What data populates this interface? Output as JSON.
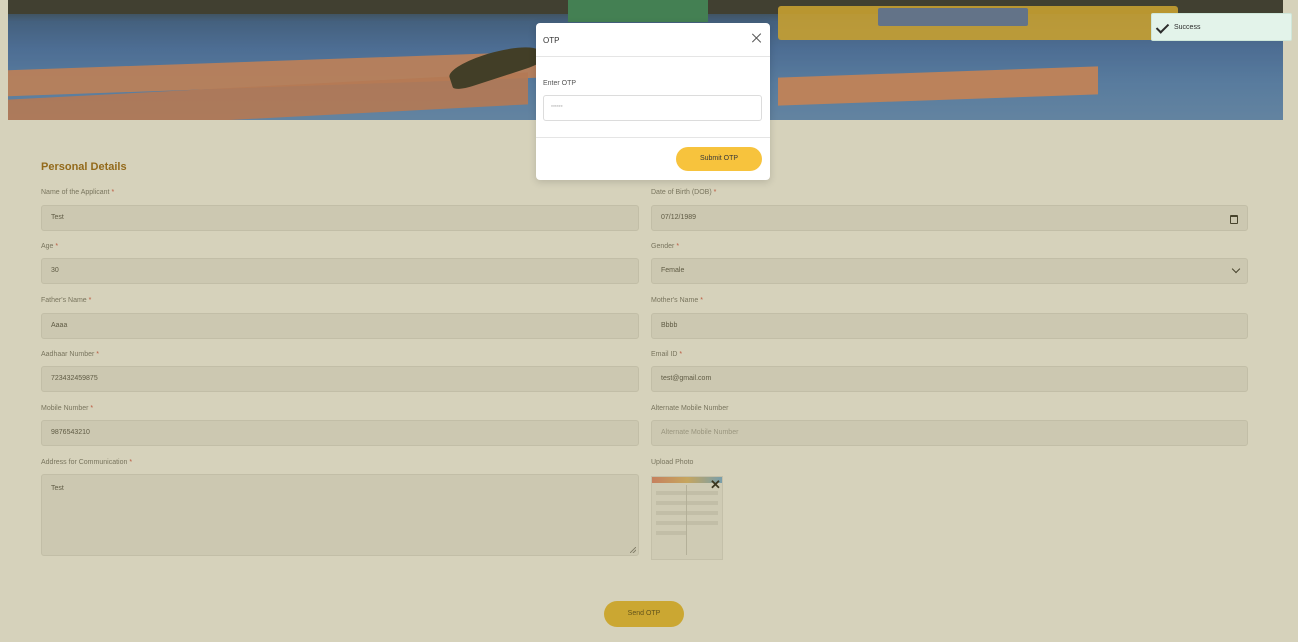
{
  "form": {
    "section_title": "Personal Details",
    "fields": {
      "applicant_name": {
        "label": "Name of the Applicant",
        "value": "Test"
      },
      "dob": {
        "label": "Date of Birth (DOB)",
        "value": "07/12/1989"
      },
      "age": {
        "label": "Age",
        "value": "30"
      },
      "gender": {
        "label": "Gender",
        "value": "Female"
      },
      "father_name": {
        "label": "Father's Name",
        "value": "Aaaa"
      },
      "mother_name": {
        "label": "Mother's Name",
        "value": "Bbbb"
      },
      "aadhaar": {
        "label": "Aadhaar Number",
        "value": "723432459875"
      },
      "email": {
        "label": "Email ID",
        "value": "test@gmail.com"
      },
      "mobile": {
        "label": "Mobile Number",
        "value": "9876543210"
      },
      "alt_mobile": {
        "label": "Alternate Mobile Number",
        "placeholder": "Alternate Mobile Number"
      },
      "address": {
        "label": "Address for Communication",
        "value": "Test"
      },
      "photo": {
        "label": "Upload Photo"
      }
    },
    "required_marker": "*",
    "send_otp_label": "Send OTP"
  },
  "otp_modal": {
    "title": "OTP",
    "input_label": "Enter OTP",
    "input_value": "******",
    "submit_label": "Submit OTP"
  },
  "toast": {
    "text": "Success"
  },
  "colors": {
    "accent": "#f0c23b",
    "section_title": "#a06a1a",
    "required": "#d9534f",
    "toast_bg": "#e3f3ea",
    "overlay": "rgba(120,105,30,0.30)"
  },
  "icons": {
    "close": "close-icon",
    "calendar": "calendar-icon",
    "chevron": "chevron-down-icon",
    "check": "check-icon",
    "remove_photo": "close-icon"
  }
}
